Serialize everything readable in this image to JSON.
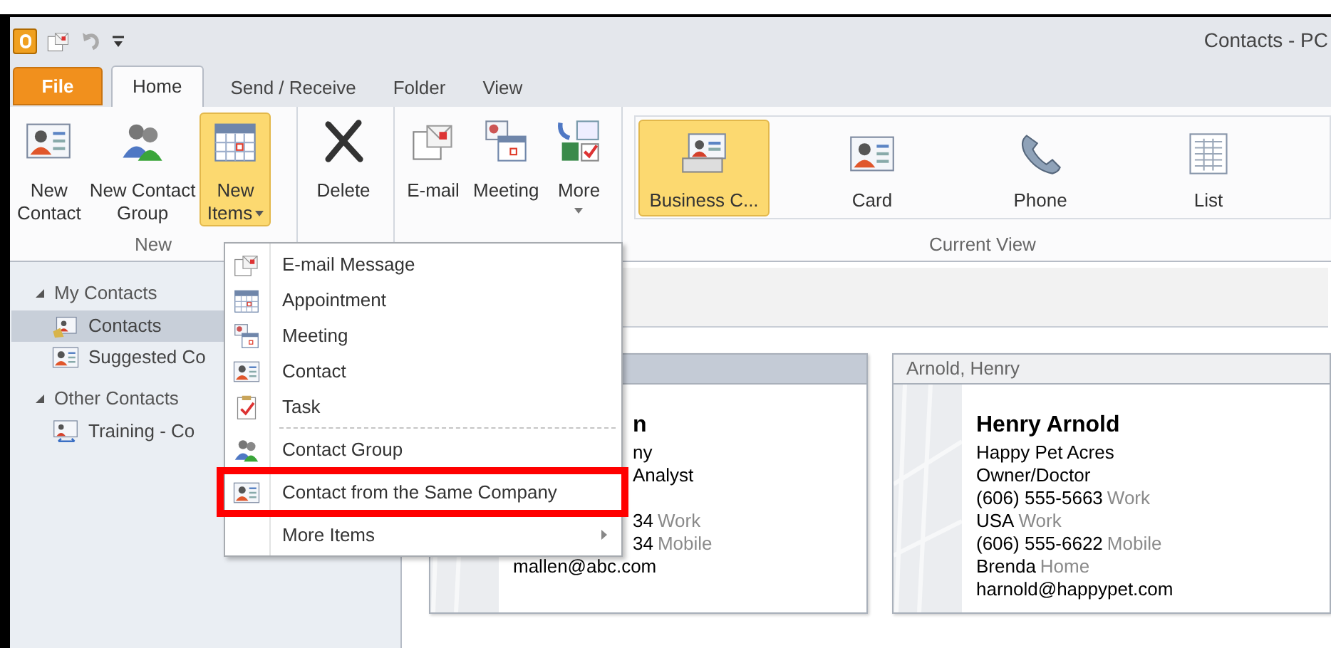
{
  "window": {
    "title": "Contacts - PC"
  },
  "tabs": [
    {
      "label": "File",
      "kind": "file",
      "selected": false
    },
    {
      "label": "Home",
      "kind": "tab",
      "selected": true
    },
    {
      "label": "Send / Receive",
      "kind": "tab",
      "selected": false
    },
    {
      "label": "Folder",
      "kind": "tab",
      "selected": false
    },
    {
      "label": "View",
      "kind": "tab",
      "selected": false
    }
  ],
  "ribbon": {
    "groups": [
      {
        "label": "New",
        "buttons": [
          {
            "lines": [
              "New",
              "Contact"
            ],
            "kind": "contact",
            "selected": false
          },
          {
            "lines": [
              "New Contact",
              "Group"
            ],
            "kind": "group",
            "selected": false
          },
          {
            "lines": [
              "New",
              "Items"
            ],
            "kind": "calendar",
            "selected": true,
            "dropdown": true
          }
        ]
      },
      {
        "buttons": [
          {
            "lines": [
              "Delete"
            ],
            "kind": "delete",
            "selected": false
          }
        ]
      },
      {
        "buttons": [
          {
            "lines": [
              "E-mail"
            ],
            "kind": "email",
            "selected": false
          },
          {
            "lines": [
              "Meeting"
            ],
            "kind": "meeting",
            "selected": false
          },
          {
            "lines": [
              "More"
            ],
            "kind": "tools",
            "selected": false,
            "dropdown": true
          }
        ]
      },
      {
        "label": "Current View",
        "buttons": [
          {
            "lines": [
              "Business C..."
            ],
            "kind": "business",
            "selected": true
          },
          {
            "lines": [
              "Card"
            ],
            "kind": "contact",
            "selected": false
          },
          {
            "lines": [
              "Phone"
            ],
            "kind": "phone",
            "selected": false
          },
          {
            "lines": [
              "List"
            ],
            "kind": "list",
            "selected": false
          }
        ]
      }
    ]
  },
  "navigation": [
    {
      "label": "My Contacts",
      "expanded": true,
      "children": [
        {
          "label": "Contacts",
          "kind": "folder-contact",
          "selected": true
        },
        {
          "label": "Suggested Co",
          "kind": "contact",
          "selected": false
        }
      ]
    },
    {
      "label": "Other Contacts",
      "expanded": true,
      "children": [
        {
          "label": "Training - Co",
          "kind": "shared",
          "selected": false
        }
      ]
    }
  ],
  "cards": [
    {
      "selected": true,
      "lines": [
        {
          "kind": "name",
          "text": "n"
        },
        {
          "kind": "line",
          "text": "ny"
        },
        {
          "kind": "line",
          "text": "Analyst"
        },
        {
          "kind": "blank"
        },
        {
          "kind": "line",
          "text": "34",
          "tag": "Work"
        },
        {
          "kind": "line",
          "text": "34",
          "tag": "Mobile"
        },
        {
          "kind": "line",
          "text": "mallen@abc.com"
        }
      ]
    },
    {
      "header": "Arnold, Henry",
      "selected": false,
      "lines": [
        {
          "kind": "name",
          "text": "Henry Arnold"
        },
        {
          "kind": "line",
          "text": "Happy Pet Acres"
        },
        {
          "kind": "line",
          "text": "Owner/Doctor"
        },
        {
          "kind": "line",
          "text": "(606) 555-5663",
          "tag": "Work"
        },
        {
          "kind": "line",
          "text": "USA",
          "tag": "Work"
        },
        {
          "kind": "line",
          "text": "(606) 555-6622",
          "tag": "Mobile"
        },
        {
          "kind": "line",
          "text": "Brenda",
          "tag": "Home"
        },
        {
          "kind": "line",
          "text": "harnold@happypet.com"
        }
      ]
    }
  ],
  "new_items_menu": [
    {
      "label": "E-mail Message",
      "kind": "email",
      "highlighted": false
    },
    {
      "label": "Appointment",
      "kind": "calendar",
      "highlighted": false
    },
    {
      "label": "Meeting",
      "kind": "meeting",
      "highlighted": false
    },
    {
      "label": "Contact",
      "kind": "contact",
      "highlighted": false
    },
    {
      "label": "Task",
      "kind": "task",
      "highlighted": false,
      "separator_after": true
    },
    {
      "label": "Contact Group",
      "kind": "group",
      "highlighted": false
    },
    {
      "label": "Contact from the Same Company",
      "kind": "contact",
      "highlighted": true
    },
    {
      "label": "More Items",
      "kind": "submenu",
      "highlighted": false
    }
  ]
}
